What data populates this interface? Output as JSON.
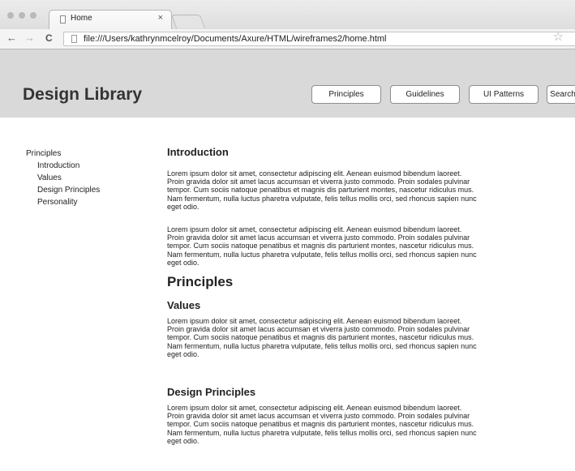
{
  "browser": {
    "tab_title": "Home",
    "tab_close": "×",
    "back_glyph": "←",
    "forward_glyph": "→",
    "reload_glyph": "C",
    "url": "file:///Users/kathrynmcelroy/Documents/Axure/HTML/wireframes2/home.html",
    "star_glyph": "☆",
    "icons": [
      "document-icon",
      "back-arrow-icon",
      "forward-arrow-icon",
      "reload-icon",
      "page-icon",
      "star-icon"
    ]
  },
  "header": {
    "title": "Design Library",
    "nav": [
      "Principles",
      "Guidelines",
      "UI Patterns",
      "Search"
    ]
  },
  "sidebar": {
    "root": "Principles",
    "items": [
      "Introduction",
      "Values",
      "Design Principles",
      "Personality"
    ]
  },
  "content": {
    "intro_heading": "Introduction",
    "principles_heading": "Principles",
    "values_heading": "Values",
    "design_principles_heading": "Design Principles",
    "lorem": "Lorem ipsum dolor sit amet, consectetur adipiscing elit. Aenean euismod bibendum laoreet. Proin gravida dolor sit amet lacus accumsan et viverra justo commodo. Proin sodales pulvinar tempor. Cum sociis natoque penatibus et magnis dis parturient montes, nascetur ridiculus mus. Nam fermentum, nulla luctus pharetra vulputate, felis tellus mollis orci, sed rhoncus sapien nunc eget odio."
  }
}
